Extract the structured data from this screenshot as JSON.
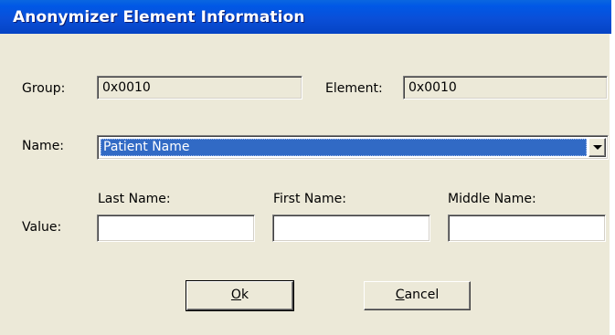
{
  "window": {
    "title": "Anonymizer Element Information"
  },
  "group": {
    "label": "Group:",
    "value": "0x0010"
  },
  "element": {
    "label": "Element:",
    "value": "0x0010"
  },
  "name": {
    "label": "Name:",
    "selected": "Patient Name"
  },
  "value": {
    "label": "Value:",
    "last_name_label": "Last Name:",
    "first_name_label": "First Name:",
    "middle_name_label": "Middle Name:",
    "last_name": "",
    "first_name": "",
    "middle_name": ""
  },
  "buttons": {
    "ok_mnemonic": "O",
    "ok_rest": "k",
    "cancel_mnemonic": "C",
    "cancel_rest": "ancel"
  },
  "colors": {
    "dialog_bg": "#ece9d8",
    "titlebar": "#0a4fd8",
    "selection": "#316ac5"
  }
}
